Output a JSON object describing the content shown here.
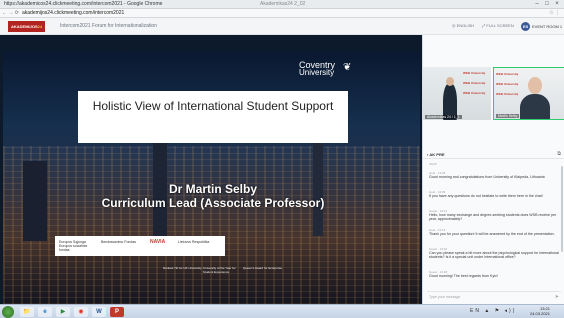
{
  "browser": {
    "tab_title": "https://akademicos24.clickmeeting.com/intercom2021 - Google Chrome",
    "center_text": "Akademikas24 2_02",
    "url": "akademijos24.clickmeeting.com/intercom2021",
    "nav_icons": "← → ⟳",
    "right_icons": "☆ ⋮"
  },
  "app": {
    "logo_text": "AKADEMIJOS",
    "logo_accent": "24",
    "event_name": "Intercom2021 Forum for Internationalization",
    "header_buttons": [
      "ENGLISH",
      "FULL SCREEN"
    ],
    "user_initials": "ES",
    "user_name": "EVENT ROOM 1"
  },
  "slide": {
    "brand_line1": "Coventry",
    "brand_line2": "University",
    "title": "Holistic View of International Student Support",
    "speaker_name": "Dr Martin Selby",
    "speaker_role": "Curriculum Lead (Associate Professor)",
    "logo_labels": [
      "Europos Sąjunga Europos socialinis fondas",
      "Bendrasavimo Fondas",
      "NAVIA",
      "Lietuvos Respublika"
    ],
    "footer_items": [
      "Ranked 7th for UK University",
      "University of the Year for Student Experience",
      "Queen's Award for Enterprise"
    ]
  },
  "videos": [
    {
      "label": "Akademikas 24 / 1_1",
      "wall_text": "WEB University"
    },
    {
      "label": "Martin Selby",
      "wall_text": "WEB University"
    }
  ],
  "chat": {
    "header": "AK PRE",
    "section": "CHAT",
    "messages": [
      {
        "meta": "Host · 13:06",
        "text": "Good morning and congratulations from University of Klaipeda, Lithuania"
      },
      {
        "meta": "Host · 13:09",
        "text": "If you have any questions do not hesitate to write them here in the chat!"
      },
      {
        "meta": "Guest · 13:11",
        "text": "Hello, how many exchange and degree-seeking students does WSB receive per year, approximately?"
      },
      {
        "meta": "Host · 13:13",
        "text": "Thank you for your question! It will be answered by the end of the presentation."
      },
      {
        "meta": "Guest · 13:16",
        "text": "Can you please speak a bit more about the psychological support for international students? Is it a special unit under International office?"
      },
      {
        "meta": "Guest · 13:18",
        "text": "Good morning! The best regards from Kyiv!"
      }
    ],
    "input_placeholder": "Type your message",
    "send_icon": "➤"
  },
  "taskbar": {
    "time": "13:21",
    "date": "24.03.2021",
    "apps": [
      "📁",
      "e",
      "▶",
      "◉",
      "W",
      "P"
    ],
    "tray": "EN ▲ ⚑ ◂))"
  }
}
